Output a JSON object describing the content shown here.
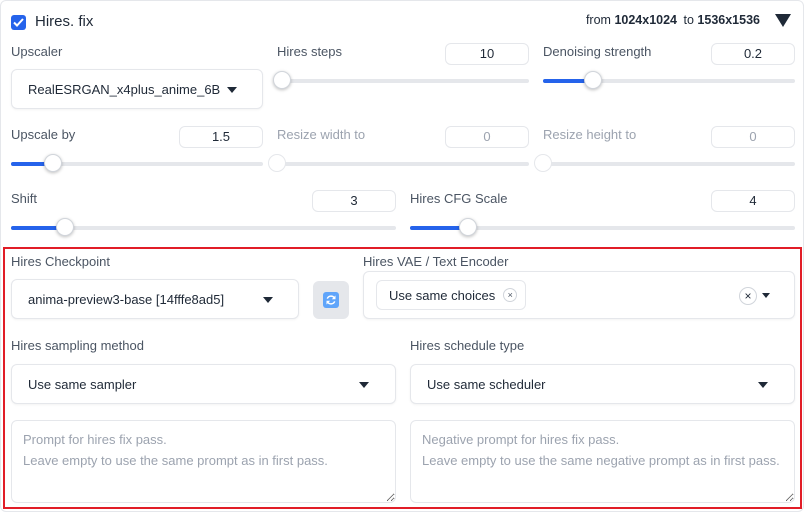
{
  "header": {
    "checkbox_checked": true,
    "title": "Hires. fix",
    "from_label": "from",
    "from_value": "1024x1024",
    "to_label": "to",
    "to_value": "1536x1536"
  },
  "upscaler": {
    "label": "Upscaler",
    "value": "RealESRGAN_x4plus_anime_6B"
  },
  "hires_steps": {
    "label": "Hires steps",
    "value": "10",
    "slider_fraction": 0.02
  },
  "denoising": {
    "label": "Denoising strength",
    "value": "0.2",
    "slider_fraction": 0.2
  },
  "upscale_by": {
    "label": "Upscale by",
    "value": "1.5",
    "slider_fraction": 0.167
  },
  "resize_width": {
    "label": "Resize width to",
    "value": "0",
    "slider_fraction": 0
  },
  "resize_height": {
    "label": "Resize height to",
    "value": "0",
    "slider_fraction": 0
  },
  "shift": {
    "label": "Shift",
    "value": "3",
    "slider_fraction": 0.14
  },
  "cfg": {
    "label": "Hires CFG Scale",
    "value": "4",
    "slider_fraction": 0.15
  },
  "checkpoint": {
    "label": "Hires Checkpoint",
    "value": "anima-preview3-base [14fffe8ad5]"
  },
  "vae": {
    "label": "Hires VAE / Text Encoder",
    "chip": "Use same choices",
    "chip_remove": "×",
    "clear": "×"
  },
  "sampler": {
    "label": "Hires sampling method",
    "value": "Use same sampler"
  },
  "scheduler": {
    "label": "Hires schedule type",
    "value": "Use same scheduler"
  },
  "prompt": {
    "placeholder": "Prompt for hires fix pass.\nLeave empty to use the same prompt as in first pass."
  },
  "neg_prompt": {
    "placeholder": "Negative prompt for hires fix pass.\nLeave empty to use the same negative prompt as in first pass."
  },
  "colors": {
    "accent": "#2563eb",
    "highlight_border": "#e11d27"
  },
  "icons": {
    "collapse": "triangle-down-icon",
    "refresh": "refresh-icon"
  }
}
